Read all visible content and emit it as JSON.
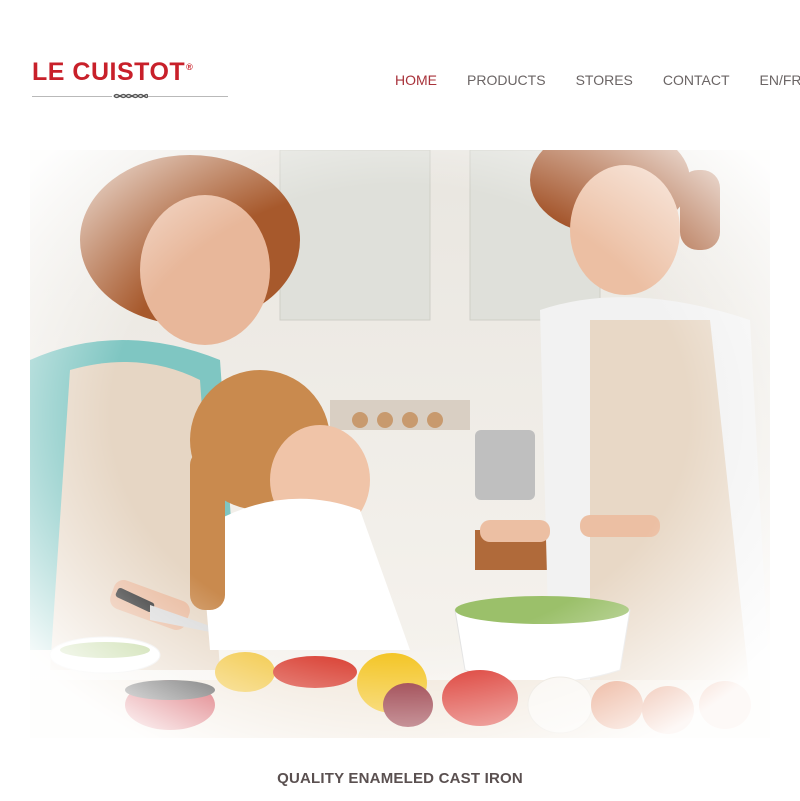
{
  "brand": {
    "name": "LE CUISTOT",
    "registered_mark": "®",
    "color": "#c8202a"
  },
  "nav": {
    "items": [
      {
        "label": "HOME",
        "active": true
      },
      {
        "label": "PRODUCTS",
        "active": false
      },
      {
        "label": "STORES",
        "active": false
      },
      {
        "label": "CONTACT",
        "active": false
      },
      {
        "label": "EN/FR",
        "active": false
      }
    ],
    "active_color": "#a8323a",
    "text_color": "#6b6565"
  },
  "hero": {
    "subject": "kitchen-family-cooking-photo"
  },
  "tagline": "QUALITY ENAMELED CAST IRON"
}
